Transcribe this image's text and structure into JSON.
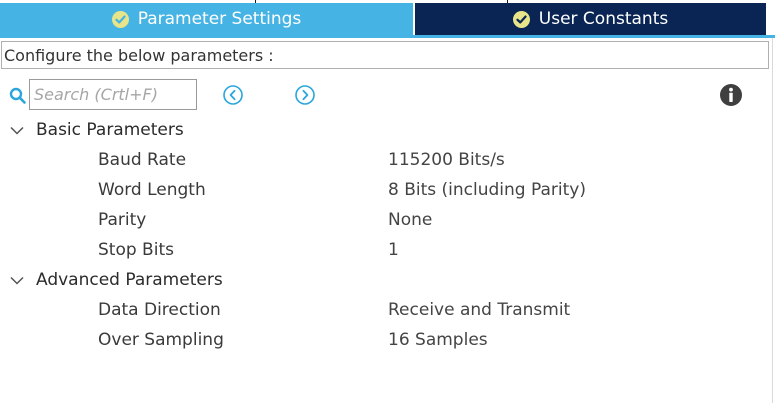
{
  "tabs": [
    {
      "label": "Parameter Settings",
      "active": true,
      "icon": "check-circle-icon"
    },
    {
      "label": "User Constants",
      "active": false,
      "icon": "check-circle-icon"
    }
  ],
  "description": "Configure the below parameters :",
  "search": {
    "placeholder": "Search (Crtl+F)",
    "value": "",
    "icon": "search-icon",
    "prev_icon": "chevron-left-circle-icon",
    "next_icon": "chevron-right-circle-icon",
    "info_icon": "info-icon"
  },
  "groups": [
    {
      "label": "Basic Parameters",
      "expanded": true,
      "params": [
        {
          "name": "Baud Rate",
          "value": "115200 Bits/s"
        },
        {
          "name": "Word Length",
          "value": "8 Bits (including Parity)"
        },
        {
          "name": "Parity",
          "value": "None"
        },
        {
          "name": "Stop Bits",
          "value": "1"
        }
      ]
    },
    {
      "label": "Advanced Parameters",
      "expanded": true,
      "params": [
        {
          "name": "Data Direction",
          "value": "Receive and Transmit"
        },
        {
          "name": "Over Sampling",
          "value": "16 Samples"
        }
      ]
    }
  ],
  "colors": {
    "tab_active_bg": "#45b3e3",
    "tab_inactive_bg": "#0a2553",
    "check_badge": "#e8e48a",
    "accent_icon": "#2aa6dc",
    "info_icon": "#3f3f3f"
  }
}
